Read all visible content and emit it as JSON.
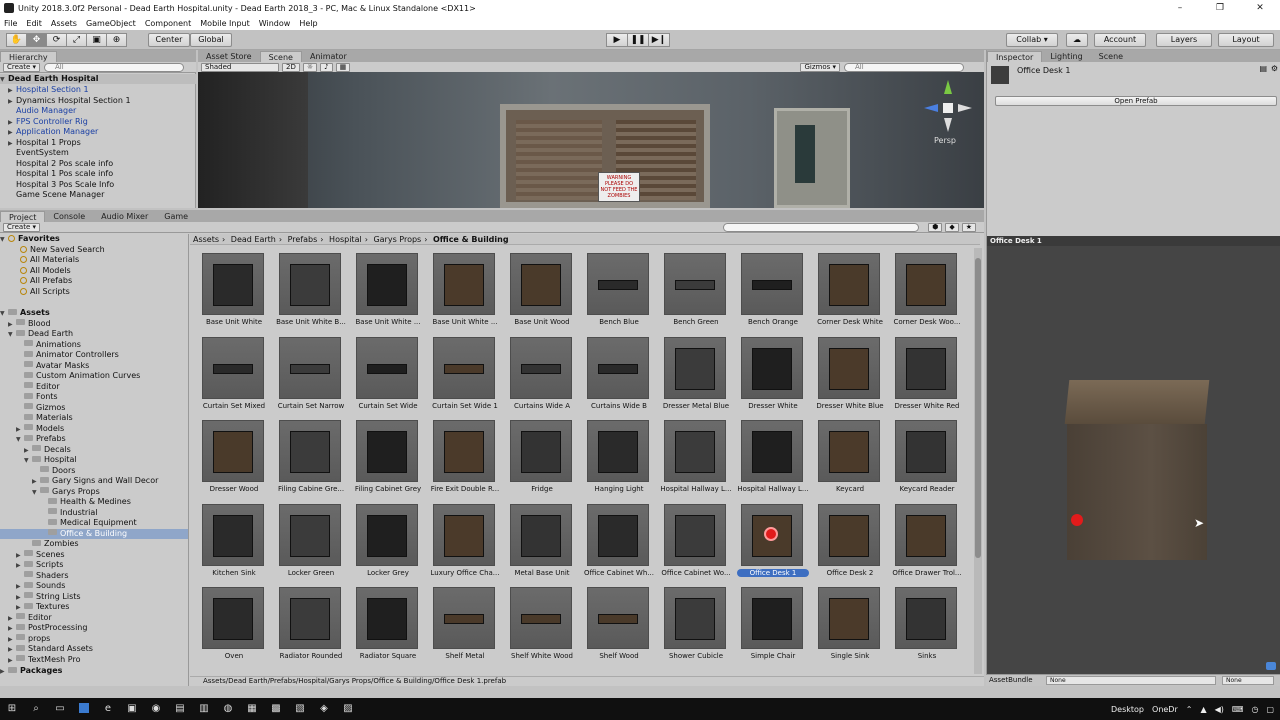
{
  "window": {
    "title": "Unity 2018.3.0f2 Personal - Dead Earth Hospital.unity - Dead Earth 2018_3 - PC, Mac & Linux Standalone <DX11>",
    "controls": [
      "–",
      "❐",
      "✕"
    ]
  },
  "menu": [
    "File",
    "Edit",
    "Assets",
    "GameObject",
    "Component",
    "Mobile Input",
    "Window",
    "Help"
  ],
  "toolbar": {
    "pivot": "Center",
    "space": "Global",
    "collab": "Collab ▾",
    "account": "Account",
    "layers": "Layers",
    "layout": "Layout"
  },
  "hierarchy": {
    "tab": "Hierarchy",
    "create": "Create ▾",
    "search_placeholder": "All",
    "scene": "Dead Earth Hospital",
    "items": [
      {
        "label": "Hospital Section 1",
        "prefab": true,
        "expandable": true
      },
      {
        "label": "Dynamics Hospital Section 1",
        "prefab": false,
        "expandable": true
      },
      {
        "label": "Audio Manager",
        "prefab": true,
        "expandable": false
      },
      {
        "label": "FPS Controller Rig",
        "prefab": true,
        "expandable": true
      },
      {
        "label": "Application Manager",
        "prefab": true,
        "expandable": true
      },
      {
        "label": "Hospital 1 Props",
        "prefab": false,
        "expandable": true
      },
      {
        "label": "EventSystem",
        "prefab": false,
        "expandable": false
      },
      {
        "label": "Hospital 2 Pos scale info",
        "prefab": false,
        "expandable": false
      },
      {
        "label": "Hospital 1 Pos scale info",
        "prefab": false,
        "expandable": false
      },
      {
        "label": "Hospital 3 Pos Scale Info",
        "prefab": false,
        "expandable": false
      },
      {
        "label": "Game Scene Manager",
        "prefab": false,
        "expandable": false
      }
    ]
  },
  "scene_view": {
    "tabs": [
      "Asset Store",
      "Scene",
      "Animator"
    ],
    "active_tab": "Scene",
    "shading": "Shaded",
    "mode2d": "2D",
    "gizmos": "Gizmos ▾",
    "search_placeholder": "All",
    "persp": "Persp",
    "sign_text": "WARNING PLEASE DO NOT FEED THE ZOMBIES"
  },
  "project": {
    "tabs": [
      "Project",
      "Console",
      "Audio Mixer",
      "Game"
    ],
    "create": "Create ▾",
    "favorites_label": "Favorites",
    "favorites": [
      "New Saved Search",
      "All Materials",
      "All Models",
      "All Prefabs",
      "All Scripts"
    ],
    "assets_label": "Assets",
    "tree": [
      {
        "label": "Blood",
        "depth": 1,
        "expand": "▶"
      },
      {
        "label": "Dead Earth",
        "depth": 1,
        "expand": "▼"
      },
      {
        "label": "Animations",
        "depth": 2,
        "expand": ""
      },
      {
        "label": "Animator Controllers",
        "depth": 2,
        "expand": ""
      },
      {
        "label": "Avatar Masks",
        "depth": 2,
        "expand": ""
      },
      {
        "label": "Custom Animation Curves",
        "depth": 2,
        "expand": ""
      },
      {
        "label": "Editor",
        "depth": 2,
        "expand": ""
      },
      {
        "label": "Fonts",
        "depth": 2,
        "expand": ""
      },
      {
        "label": "Gizmos",
        "depth": 2,
        "expand": ""
      },
      {
        "label": "Materials",
        "depth": 2,
        "expand": ""
      },
      {
        "label": "Models",
        "depth": 2,
        "expand": "▶"
      },
      {
        "label": "Prefabs",
        "depth": 2,
        "expand": "▼"
      },
      {
        "label": "Decals",
        "depth": 3,
        "expand": "▶"
      },
      {
        "label": "Hospital",
        "depth": 3,
        "expand": "▼"
      },
      {
        "label": "Doors",
        "depth": 4,
        "expand": ""
      },
      {
        "label": "Gary Signs and Wall Decor",
        "depth": 4,
        "expand": "▶"
      },
      {
        "label": "Garys Props",
        "depth": 4,
        "expand": "▼"
      },
      {
        "label": "Health & Medines",
        "depth": 5,
        "expand": ""
      },
      {
        "label": "Industrial",
        "depth": 5,
        "expand": ""
      },
      {
        "label": "Medical Equipment",
        "depth": 5,
        "expand": ""
      },
      {
        "label": "Office & Building",
        "depth": 5,
        "expand": "",
        "selected": true
      },
      {
        "label": "Zombies",
        "depth": 3,
        "expand": ""
      },
      {
        "label": "Scenes",
        "depth": 2,
        "expand": "▶"
      },
      {
        "label": "Scripts",
        "depth": 2,
        "expand": "▶"
      },
      {
        "label": "Shaders",
        "depth": 2,
        "expand": ""
      },
      {
        "label": "Sounds",
        "depth": 2,
        "expand": "▶"
      },
      {
        "label": "String Lists",
        "depth": 2,
        "expand": "▶"
      },
      {
        "label": "Textures",
        "depth": 2,
        "expand": "▶"
      },
      {
        "label": "Editor",
        "depth": 1,
        "expand": "▶"
      },
      {
        "label": "PostProcessing",
        "depth": 1,
        "expand": "▶"
      },
      {
        "label": "props",
        "depth": 1,
        "expand": "▶"
      },
      {
        "label": "Standard Assets",
        "depth": 1,
        "expand": "▶"
      },
      {
        "label": "TextMesh Pro",
        "depth": 1,
        "expand": "▶"
      }
    ],
    "packages_label": "Packages",
    "breadcrumb": [
      "Assets",
      "Dead Earth",
      "Prefabs",
      "Hospital",
      "Garys Props",
      "Office & Building"
    ],
    "assets": [
      "Base Unit White",
      "Base Unit White B...",
      "Base Unit White ...",
      "Base Unit White ...",
      "Base Unit Wood",
      "Bench Blue",
      "Bench Green",
      "Bench Orange",
      "Corner Desk White",
      "Corner Desk Woo...",
      "Curtain Set Mixed",
      "Curtain Set Narrow",
      "Curtain Set Wide",
      "Curtain Set Wide 1",
      "Curtains Wide A",
      "Curtains Wide B",
      "Dresser Metal Blue",
      "Dresser White",
      "Dresser White Blue",
      "Dresser White Red",
      "Dresser Wood",
      "Filing Cabine Gre...",
      "Filing Cabinet Grey",
      "Fire Exit Double R...",
      "Fridge",
      "Hanging Light",
      "Hospital Hallway L...",
      "Hospital Hallway L...",
      "Keycard",
      "Keycard Reader",
      "Kitchen Sink",
      "Locker Green",
      "Locker Grey",
      "Luxury Office Cha...",
      "Metal Base Unit",
      "Office Cabinet Wh...",
      "Office Cabinet Wo...",
      "Office Desk 1",
      "Office Desk 2",
      "Office Drawer Trol...",
      "Oven",
      "Radiator Rounded",
      "Radiator Square",
      "Shelf Metal",
      "Shelf White Wood",
      "Shelf Wood",
      "Shower Cubicle",
      "Simple Chair",
      "Single Sink",
      "Sinks"
    ],
    "selected_asset": "Office Desk 1",
    "path": "Assets/Dead Earth/Prefabs/Hospital/Garys Props/Office & Building/Office Desk 1.prefab"
  },
  "inspector": {
    "tabs": [
      "Inspector",
      "Lighting",
      "Scene"
    ],
    "object_name": "Office Desk 1",
    "open_prefab": "Open Prefab"
  },
  "preview": {
    "title": "Office Desk 1",
    "assetbundle_label": "AssetBundle",
    "assetbundle_value": "None",
    "variant_value": "None"
  },
  "taskbar": {
    "desktop": "Desktop",
    "onedrive": "OneDr"
  }
}
